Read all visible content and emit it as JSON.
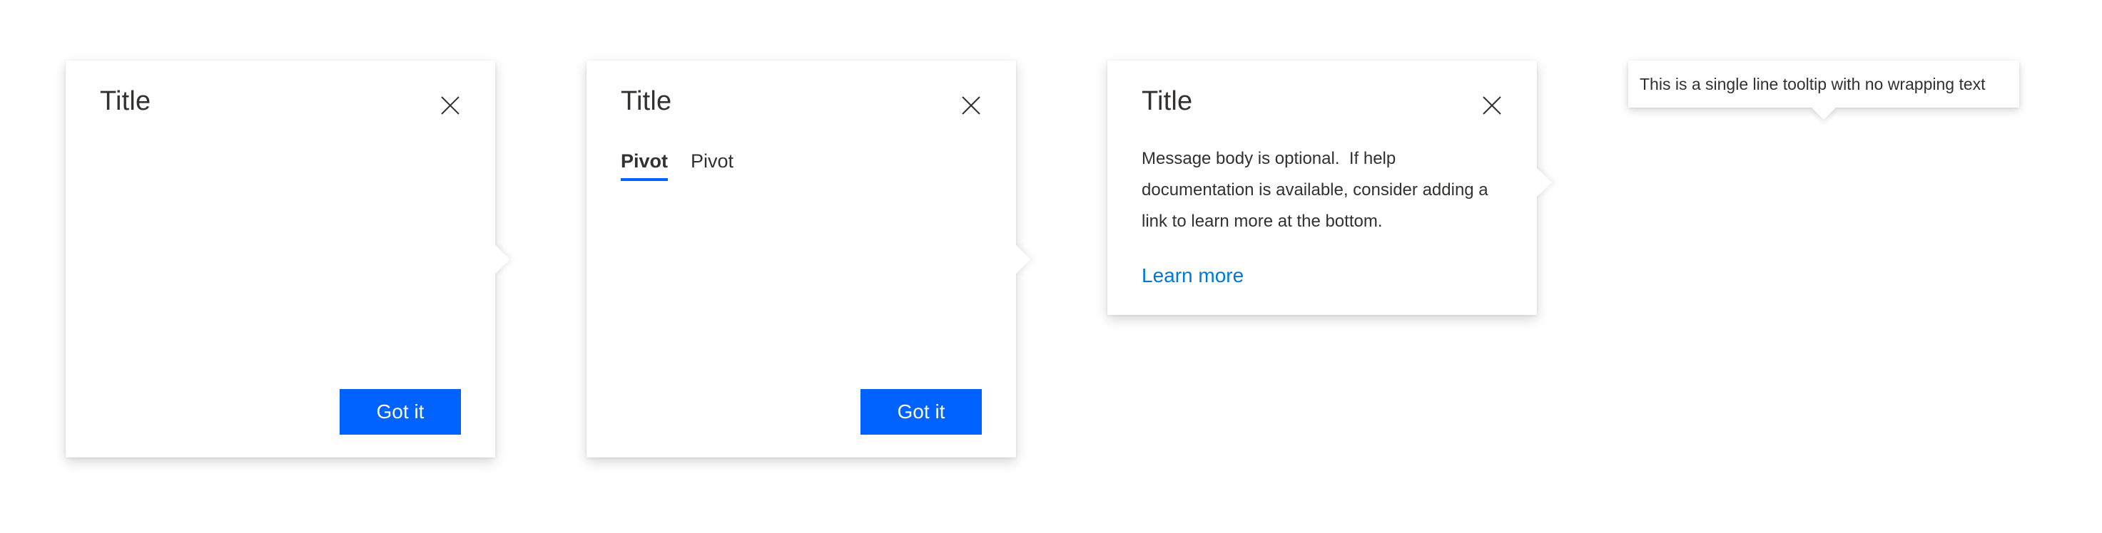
{
  "callouts": [
    {
      "title": "Title",
      "close_icon": "close-icon",
      "button_label": "Got it"
    },
    {
      "title": "Title",
      "close_icon": "close-icon",
      "pivots": [
        {
          "label": "Pivot",
          "selected": true
        },
        {
          "label": "Pivot",
          "selected": false
        }
      ],
      "button_label": "Got it"
    },
    {
      "title": "Title",
      "close_icon": "close-icon",
      "body_line_1": "Message body is optional.  If help",
      "body_line_2": "documentation is available, consider adding a",
      "body_line_3": "link to learn more at the bottom.",
      "link_label": "Learn more"
    }
  ],
  "tooltip": {
    "text": "This is a single line tooltip with no wrapping text"
  },
  "colors": {
    "primary_button": "#0062ff",
    "link": "#0078d4",
    "text": "#323130",
    "background": "#ffffff"
  }
}
